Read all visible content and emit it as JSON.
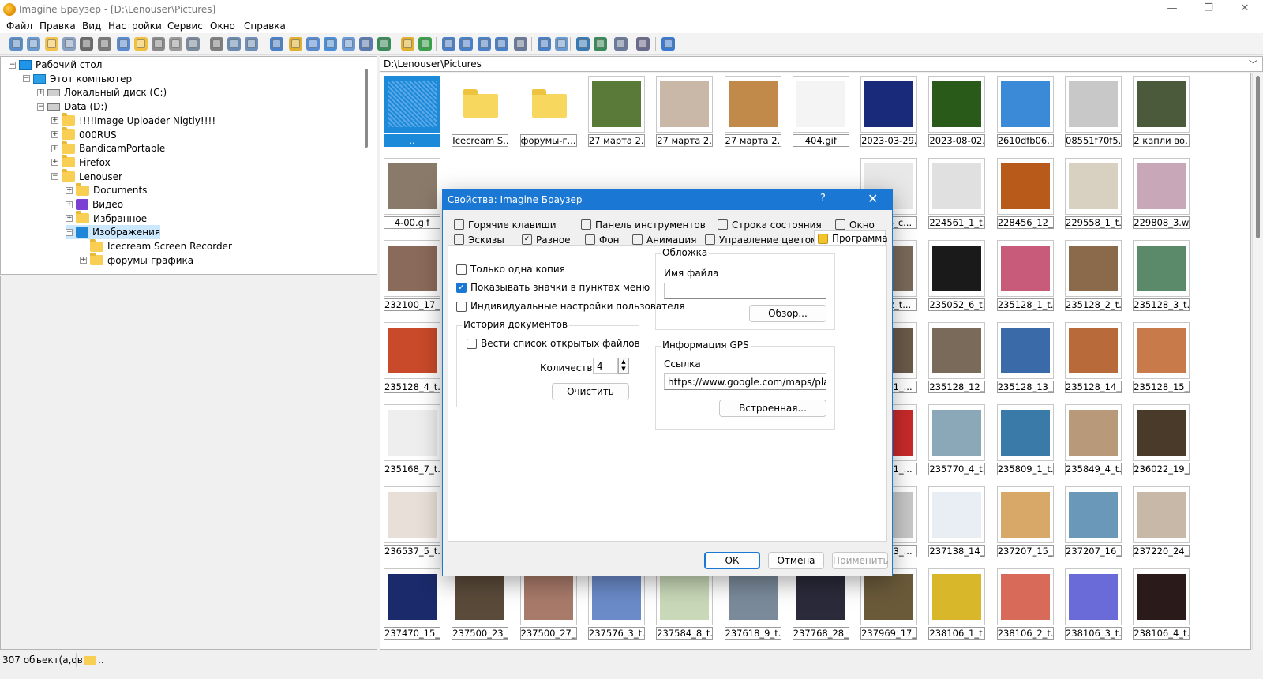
{
  "window": {
    "title": "Imagine Браузер - [D:\\Lenouser\\Pictures]",
    "min": "—",
    "max": "❐",
    "close": "✕"
  },
  "menu": [
    "Файл",
    "Правка",
    "Вид",
    "Настройки",
    "Сервис",
    "Окно",
    "Справка"
  ],
  "toolbar": {
    "icons": [
      "view-icon",
      "open-icon",
      "folder-open-icon",
      "copy-icon",
      "print-icon",
      "info-icon",
      "save-icon",
      "new-folder-icon",
      "rename-icon",
      "delete-icon",
      "properties-icon",
      "cut-icon",
      "copy-files-icon",
      "paste-icon",
      "layout-1-icon",
      "tree-icon",
      "preview-icon",
      "thumbnails-icon",
      "grid-icon",
      "panel-icon",
      "slideshow-icon",
      "up-folder-icon",
      "refresh-icon",
      "view-large-icon",
      "view-medium-icon",
      "view-small-icon",
      "view-details-icon",
      "tools-icon",
      "batch-convert-icon",
      "batch-rename-icon",
      "capture-icon",
      "film-icon",
      "edit-icon",
      "settings-icon",
      "help-icon"
    ]
  },
  "tree": [
    {
      "label": "Рабочий стол",
      "level": 0,
      "exp": "−",
      "icon": "desktop"
    },
    {
      "label": "Этот компьютер",
      "level": 1,
      "exp": "−",
      "icon": "pc"
    },
    {
      "label": "Локальный диск (C:)",
      "level": 2,
      "exp": "+",
      "icon": "disk"
    },
    {
      "label": "Data (D:)",
      "level": 2,
      "exp": "−",
      "icon": "disk"
    },
    {
      "label": "!!!!Image Uploader Nigtly!!!!",
      "level": 3,
      "exp": "+",
      "icon": "folder"
    },
    {
      "label": "000RUS",
      "level": 3,
      "exp": "+",
      "icon": "folder"
    },
    {
      "label": "BandicamPortable",
      "level": 3,
      "exp": "+",
      "icon": "folder"
    },
    {
      "label": "Firefox",
      "level": 3,
      "exp": "+",
      "icon": "folder"
    },
    {
      "label": "Lenouser",
      "level": 3,
      "exp": "−",
      "icon": "folder"
    },
    {
      "label": "Documents",
      "level": 4,
      "exp": "+",
      "icon": "folder"
    },
    {
      "label": "Видео",
      "level": 4,
      "exp": "+",
      "icon": "video"
    },
    {
      "label": "Избранное",
      "level": 4,
      "exp": "+",
      "icon": "folder"
    },
    {
      "label": "Изображения",
      "level": 4,
      "exp": "−",
      "icon": "pics",
      "selected": true
    },
    {
      "label": "Icecream Screen Recorder",
      "level": 5,
      "exp": "",
      "icon": "folder"
    },
    {
      "label": "форумы-графика",
      "level": 5,
      "exp": "+",
      "icon": "folder"
    }
  ],
  "address": "D:\\Lenouser\\Pictures",
  "thumbs": [
    [
      "..",
      "Icecream S...",
      "форумы-г...",
      "27 марта 2...",
      "27 марта 2...",
      "27 марта 2...",
      "404.gif",
      "2023-03-29...",
      "2023-08-02...",
      "2610dfb06...",
      "08551f70f5...",
      "2 капли во..."
    ],
    [
      "4-00.gif",
      "",
      "",
      "",
      "",
      "",
      "",
      "",
      "460_6_c...",
      "224561_1_t...",
      "228456_12_...",
      "229558_1_t...",
      "229808_3.w..."
    ],
    [
      "232100_17_...",
      "",
      "",
      "",
      "",
      "",
      "",
      "",
      "052_2_t...",
      "235052_6_t...",
      "235128_1_t...",
      "235128_2_t...",
      "235128_3_t..."
    ],
    [
      "235128_4_t...",
      "",
      "",
      "",
      "",
      "",
      "",
      "",
      "128_11_...",
      "235128_12_...",
      "235128_13_...",
      "235128_14_...",
      "235128_15_..."
    ],
    [
      "235168_7_t...",
      "",
      "",
      "",
      "",
      "",
      "",
      "",
      "582_11_...",
      "235770_4_t...",
      "235809_1_t...",
      "235849_4_t...",
      "236022_19_..."
    ],
    [
      "236537_5_t...",
      "",
      "",
      "",
      "",
      "",
      "",
      "",
      "138_13_...",
      "237138_14_...",
      "237207_15_...",
      "237207_16_...",
      "237220_24_..."
    ],
    [
      "237470_15_...",
      "237500_23_...",
      "237500_27_...",
      "237576_3_t...",
      "237584_8_t...",
      "237618_9_t...",
      "237768_28_...",
      "237969_17_...",
      "238106_1_t...",
      "238106_2_t...",
      "238106_3_t...",
      "238106_4_t..."
    ]
  ],
  "thumb_colors": [
    [
      "#1c8ad8",
      "folder",
      "folder",
      "#5a7a3a",
      "#c9b8a8",
      "#c28a4a",
      "#f4f4f4",
      "#1a2a7a",
      "#2a5a1a",
      "#3a8ad8",
      "#c8c8c8",
      "#4a5a3a"
    ],
    [
      "#8a7a6a",
      "",
      "",
      "",
      "",
      "",
      "",
      "",
      "#e8e8e8",
      "#e0e0e0",
      "#b85a1a",
      "#d8d0c0",
      "#c8a8b8"
    ],
    [
      "#8a6a5a",
      "",
      "",
      "",
      "",
      "",
      "",
      "",
      "#7a6a5a",
      "#1a1a1a",
      "#c85a7a",
      "#8a6a4a",
      "#5a8a6a"
    ],
    [
      "#c84a2a",
      "",
      "",
      "",
      "",
      "",
      "",
      "",
      "#6a5a4a",
      "#7a6a5a",
      "#3a6aa8",
      "#b86a3a",
      "#c87a4a"
    ],
    [
      "#eeeeee",
      "",
      "",
      "",
      "",
      "",
      "",
      "",
      "#c82a2a",
      "#8aa8b8",
      "#3a7aa8",
      "#b89a7a",
      "#4a3a2a"
    ],
    [
      "#e8e0d8",
      "",
      "",
      "",
      "",
      "",
      "",
      "",
      "#c8c8c8",
      "#e8eef4",
      "#d8a868",
      "#6a98b8",
      "#c8b8a8"
    ],
    [
      "#1a2a6a",
      "#5a4a3a",
      "#a87a6a",
      "#6a8ac8",
      "#c8d8b8",
      "#7a8a9a",
      "#2a2a3a",
      "#6a5a3a",
      "#d8b82a",
      "#d86a5a",
      "#6a6ad8",
      "#2a1a1a"
    ]
  ],
  "status": {
    "count": "307 объект(а,ов)",
    "path": ".."
  },
  "dialog": {
    "title": "Свойства: Imagine Браузер",
    "help": "?",
    "close": "✕",
    "tabs_row1": [
      "Горячие клавиши",
      "Панель инструментов",
      "Строка состояния",
      "Окно"
    ],
    "tabs_row2": [
      "Эскизы",
      "Разное",
      "Фон",
      "Анимация",
      "Управление цветом",
      "Программа"
    ],
    "cb_single": "Только одна копия",
    "cb_icons": "Показывать значки в пунктах меню",
    "cb_user": "Индивидуальные настройки пользователя",
    "history_title": "История документов",
    "cb_history": "Вести список открытых файлов",
    "count_label": "Количество:",
    "count_value": "4",
    "clear_btn": "Очистить",
    "cover_title": "Обложка",
    "filename_label": "Имя файла",
    "filename_value": "",
    "browse_btn": "Обзор...",
    "gps_title": "Информация GPS",
    "link_label": "Ссылка",
    "link_value": "https://www.google.com/maps/place/<LA",
    "builtin_btn": "Встроенная...",
    "ok": "ОК",
    "cancel": "Отмена",
    "apply": "Применить"
  }
}
